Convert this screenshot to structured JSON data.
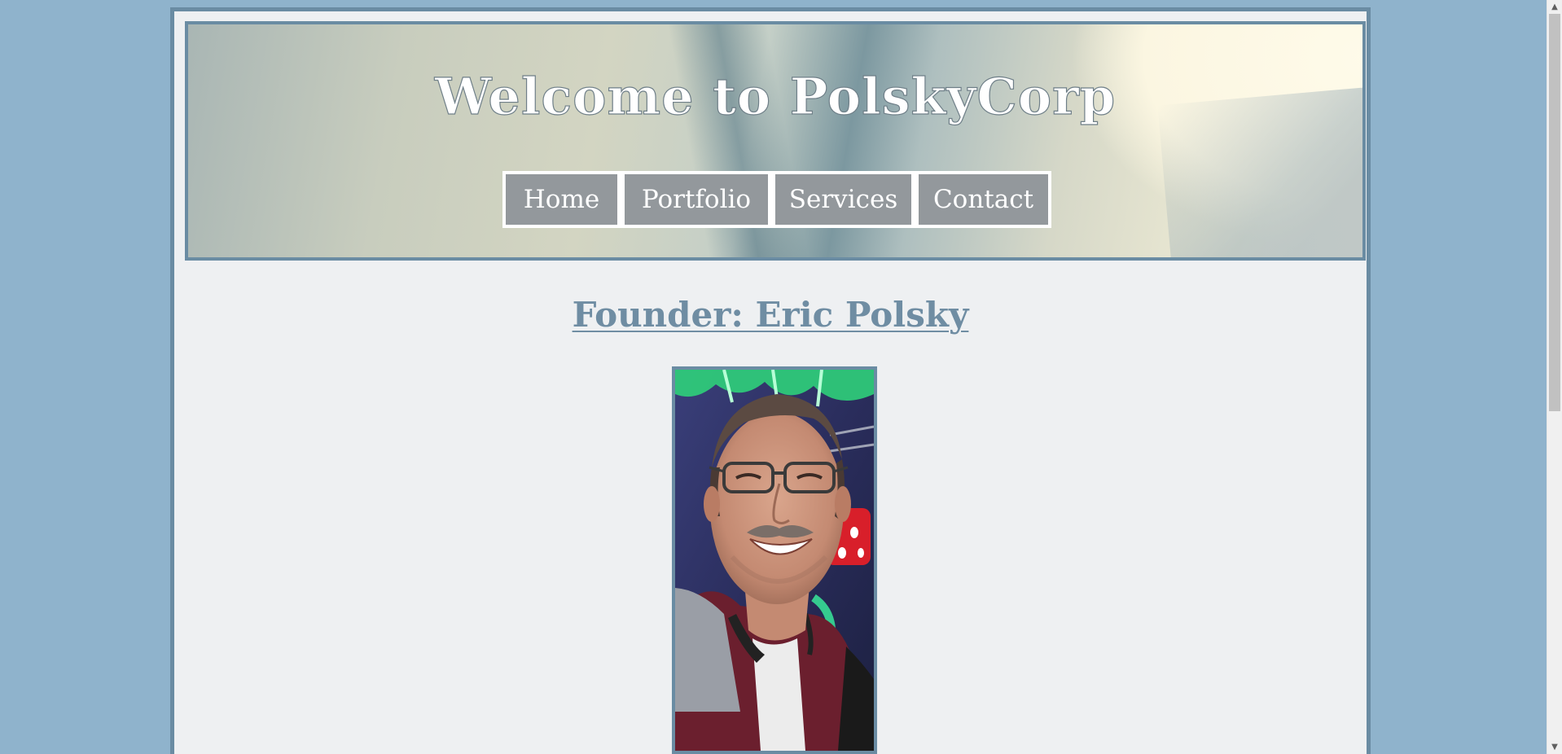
{
  "header": {
    "title": "Welcome to PolskyCorp"
  },
  "nav": {
    "items": [
      {
        "label": "Home"
      },
      {
        "label": "Portfolio"
      },
      {
        "label": "Services"
      },
      {
        "label": "Contact"
      }
    ]
  },
  "main": {
    "heading": "Founder: Eric Polsky"
  },
  "colors": {
    "page_background": "#8fb3cc",
    "frame_border": "#6a8ca3",
    "content_background": "#eef0f2",
    "nav_button": "#93989c",
    "heading": "#6f8da3"
  },
  "scrollbar": {
    "up_icon": "chevron-up-icon",
    "down_icon": "chevron-down-icon"
  }
}
